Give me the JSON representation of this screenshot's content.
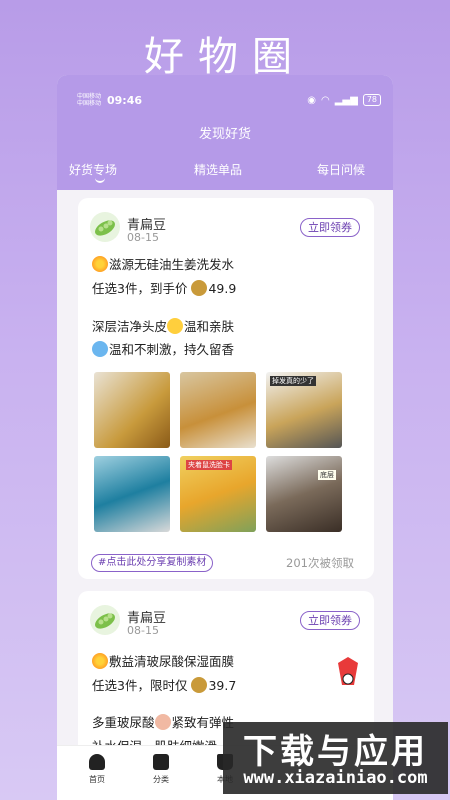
{
  "promo_title": "好物圈",
  "status_bar": {
    "carrier_line1": "中国移动",
    "carrier_line2": "中国移动",
    "time": "09:46",
    "battery": "78"
  },
  "app_title": "发现好货",
  "tabs": [
    {
      "label": "好货专场",
      "active": true
    },
    {
      "label": "精选单品",
      "active": false
    },
    {
      "label": "每日问候",
      "active": false
    }
  ],
  "posts": [
    {
      "user": "青扁豆",
      "date": "08-15",
      "claim_label": "立即领券",
      "lines": [
        "滋源无硅油生姜洗发水",
        "任选3件，到手价",
        "49.9",
        "深层洁净头皮",
        "温和亲肤",
        "温和不刺激，持久留香"
      ],
      "image_captions": [
        "",
        "",
        "掉发真的少了",
        "",
        "夹着鼠洗脸卡",
        "底层"
      ],
      "share_tag": "#点击此处分享复制素材",
      "claim_count": "201次被领取"
    },
    {
      "user": "青扁豆",
      "date": "08-15",
      "claim_label": "立即领券",
      "lines": [
        "敷益清玻尿酸保湿面膜",
        "任选3件，限时仅",
        "39.7",
        "多重玻尿酸",
        "紧致有弹性",
        "补水保湿，肌肤细嫩滑"
      ]
    }
  ],
  "bottom_nav": [
    {
      "label": "首页",
      "icon": "home-icon"
    },
    {
      "label": "分类",
      "icon": "grid-icon"
    },
    {
      "label": "本地",
      "icon": "bag-icon"
    }
  ],
  "watermark": {
    "main": "下载与应用",
    "sub": "www.xiazainiao.com"
  },
  "colors": {
    "accent": "#b59ae8",
    "brand_purple": "#6b3fb0"
  }
}
